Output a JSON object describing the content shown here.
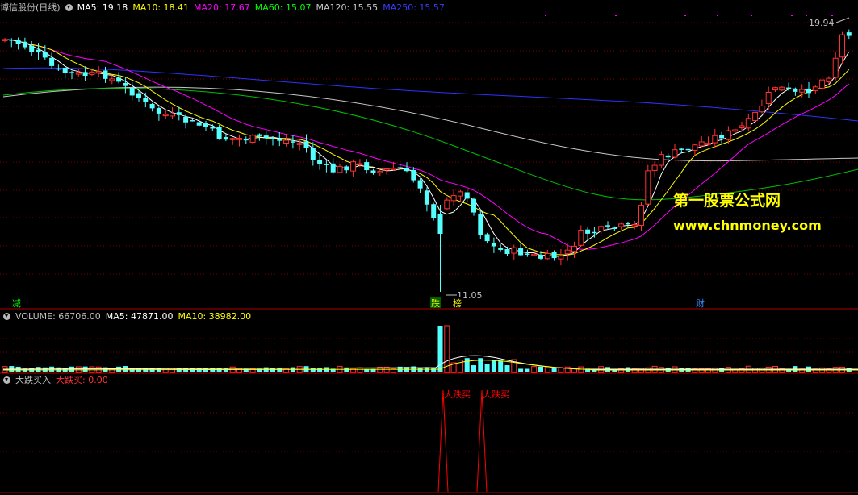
{
  "header": {
    "stock_name": "博信股份(日线)",
    "ma5": "MA5: 19.18",
    "ma10": "MA10: 18.41",
    "ma20": "MA20: 17.67",
    "ma60": "MA60: 15.07",
    "ma120": "MA120: 15.55",
    "ma250": "MA250: 15.57"
  },
  "volume_header": {
    "volume": "VOLUME: 66706.00",
    "ma5": "MA5: 47871.00",
    "ma10": "MA10: 38982.00"
  },
  "indicator_header": {
    "name": "大跌买入",
    "value": "大跌买: 0.00"
  },
  "watermark": {
    "line1": "第一股票公式网",
    "line2": "www.chnmoney.com"
  },
  "markers": {
    "left": "减",
    "mid1": "跌",
    "mid2": "榜",
    "right": "财"
  },
  "annotations": {
    "high": "19.94",
    "low": "11.05",
    "signal": "大跌买"
  },
  "colors": {
    "up": "#ff3232",
    "down": "#54ffff",
    "ma5": "#ffffff",
    "ma10": "#ffff00",
    "ma20": "#ff00ff",
    "ma60": "#00c000",
    "ma120": "#c8c8c8",
    "ma250": "#3030ff",
    "grid": "#800000",
    "signal": "#ff0000"
  },
  "chart_data": {
    "type": "candlestick",
    "y_high": 19.94,
    "y_low": 11.05,
    "signals": [
      {
        "label": "大跌买",
        "value": 1
      },
      {
        "label": "大跌买",
        "value": 1
      }
    ],
    "last_values": {
      "MA5": 19.18,
      "MA10": 18.41,
      "MA20": 17.67,
      "MA60": 15.07,
      "MA120": 15.55,
      "MA250": 15.57,
      "VOLUME": 66706,
      "VOL_MA5": 47871,
      "VOL_MA10": 38982,
      "大跌买": 0
    }
  }
}
